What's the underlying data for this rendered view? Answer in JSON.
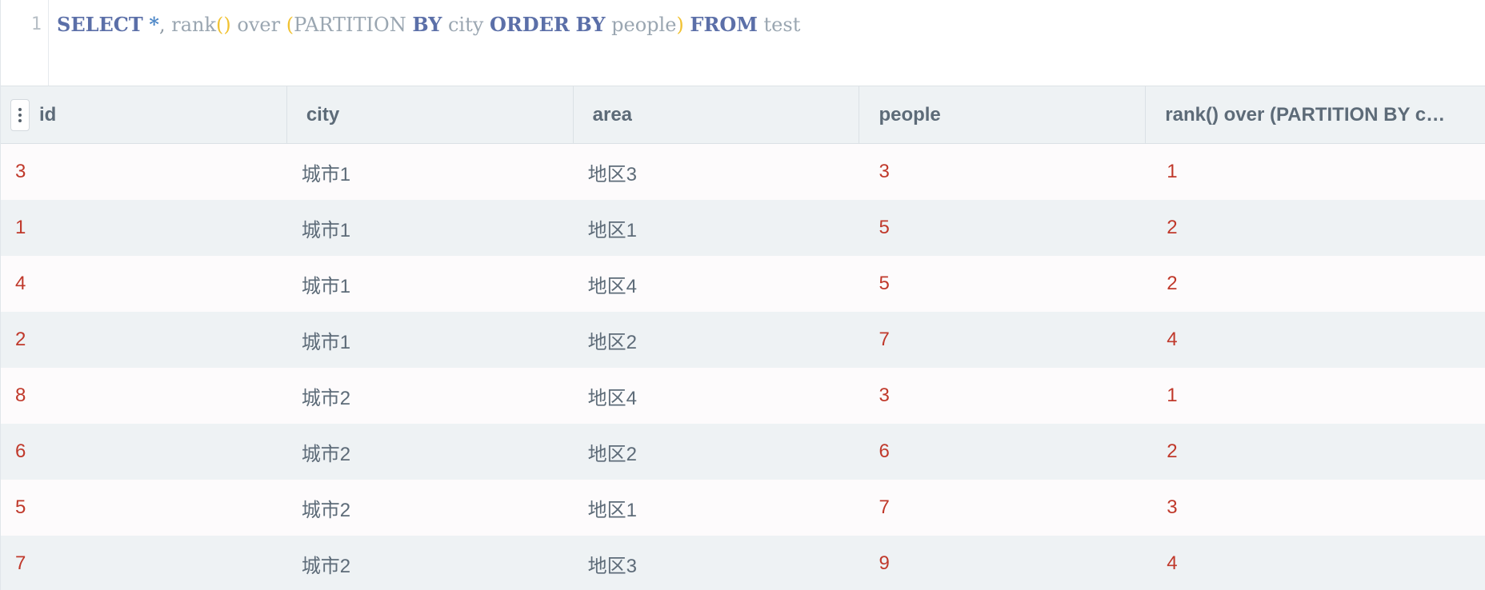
{
  "editor": {
    "line_number": "1",
    "tokens": {
      "select": "SELECT",
      "star": "*",
      "comma": ",",
      "rank": "rank",
      "paren_open1": "(",
      "paren_close1": ")",
      "over": "over",
      "paren_open2": "(",
      "partition": "PARTITION",
      "by1": "BY",
      "city": "city",
      "order": "ORDER",
      "by2": "BY",
      "people": "people",
      "paren_close2": ")",
      "from": "FROM",
      "table": "test"
    }
  },
  "grid": {
    "columns": [
      {
        "label": "id"
      },
      {
        "label": "city"
      },
      {
        "label": "area"
      },
      {
        "label": "people"
      },
      {
        "label": "rank() over (PARTITION BY c…"
      }
    ],
    "rows": [
      [
        "3",
        "城市1",
        "地区3",
        "3",
        "1"
      ],
      [
        "1",
        "城市1",
        "地区1",
        "5",
        "2"
      ],
      [
        "4",
        "城市1",
        "地区4",
        "5",
        "2"
      ],
      [
        "2",
        "城市1",
        "地区2",
        "7",
        "4"
      ],
      [
        "8",
        "城市2",
        "地区4",
        "3",
        "1"
      ],
      [
        "6",
        "城市2",
        "地区2",
        "6",
        "2"
      ],
      [
        "5",
        "城市2",
        "地区1",
        "7",
        "3"
      ],
      [
        "7",
        "城市2",
        "地区3",
        "9",
        "4"
      ]
    ]
  },
  "colors": {
    "keyword": "#5b6fa8",
    "number": "#c0392b",
    "text": "#5d6b78",
    "paren": "#f1c232"
  }
}
